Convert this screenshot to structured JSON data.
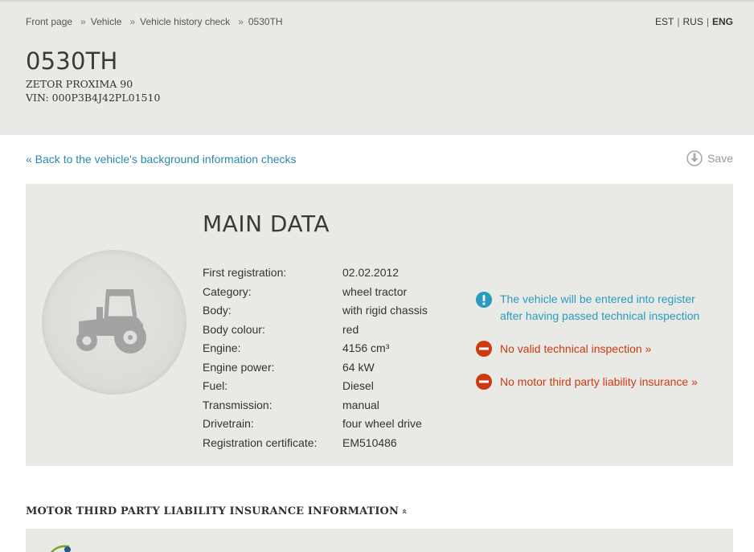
{
  "breadcrumb": {
    "items": [
      "Front page",
      "Vehicle",
      "Vehicle history check",
      "0530TH"
    ],
    "separator": "»"
  },
  "languages": {
    "items": [
      "EST",
      "RUS",
      "ENG"
    ],
    "active": "ENG",
    "separator": "|"
  },
  "vehicle": {
    "plate": "0530TH",
    "model": "ZETOR PROXIMA 90",
    "vin": "VIN: 000P3B4J42PL01510"
  },
  "actions": {
    "back_link": "« Back to the vehicle's background information checks",
    "save_label": "Save",
    "save_icon": "download-icon"
  },
  "main_data": {
    "title": "MAIN DATA",
    "image_icon": "tractor-icon",
    "rows": [
      {
        "label": "First registration:",
        "value": "02.02.2012"
      },
      {
        "label": "Category:",
        "value": "wheel tractor"
      },
      {
        "label": "Body:",
        "value": "with rigid chassis"
      },
      {
        "label": "Body colour:",
        "value": "red"
      },
      {
        "label": "Engine:",
        "value": "4156 cm³"
      },
      {
        "label": "Engine power:",
        "value": "64 kW"
      },
      {
        "label": "Fuel:",
        "value": "Diesel"
      },
      {
        "label": "Transmission:",
        "value": "manual"
      },
      {
        "label": "Drivetrain:",
        "value": "four wheel drive"
      },
      {
        "label": "Registration certificate:",
        "value": "EM510486"
      }
    ]
  },
  "notices": [
    {
      "type": "info",
      "icon": "exclamation-icon",
      "text": "The vehicle will be entered into register after having passed technical inspection",
      "color": "#2a9bc0"
    },
    {
      "type": "warning",
      "icon": "no-entry-icon",
      "text": "No valid technical inspection »",
      "color": "#cc3a12"
    },
    {
      "type": "warning",
      "icon": "no-entry-icon",
      "text": "No motor third party liability insurance »",
      "color": "#cc3a12"
    }
  ],
  "insurance_section": {
    "title": "MOTOR THIRD PARTY LIABILITY INSURANCE INFORMATION",
    "chevron": "«",
    "chevron_icon": "chevron-up-double-icon"
  },
  "colors": {
    "panel_bg": "#e9eae5",
    "link": "#2a8aaa",
    "info": "#2a9bc0",
    "warning": "#cc3a12"
  }
}
